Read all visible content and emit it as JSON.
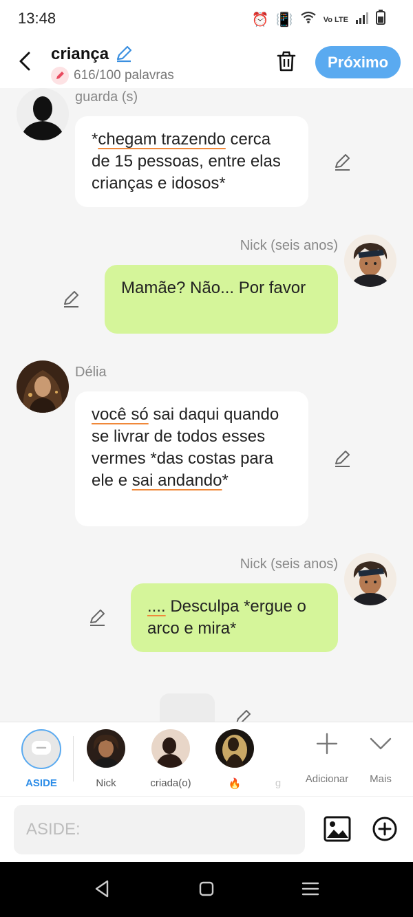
{
  "status": {
    "time": "13:48",
    "network_label": "Vo LTE"
  },
  "header": {
    "title": "criança",
    "word_count": "616/100 palavras",
    "next_label": "Próximo"
  },
  "messages": [
    {
      "sender": "guarda (s)",
      "parts": [
        {
          "t": "*",
          "u": false
        },
        {
          "t": "chegam trazendo",
          "u": true
        },
        {
          "t": " cerca de 15 pessoas, entre elas crianças e idosos*",
          "u": false
        }
      ]
    },
    {
      "sender": "Nick (seis anos)",
      "parts": [
        {
          "t": "Mamãe? Não... Por favor",
          "u": false
        }
      ]
    },
    {
      "sender": "Délia",
      "parts": [
        {
          "t": "você só",
          "u": true
        },
        {
          "t": " sai daqui quando se livrar de todos esses vermes *das costas para ele e ",
          "u": false
        },
        {
          "t": "sai andando",
          "u": true
        },
        {
          "t": "*",
          "u": false
        }
      ]
    },
    {
      "sender": "Nick (seis anos)",
      "parts": [
        {
          "t": "....",
          "u": true
        },
        {
          "t": " Desculpa *ergue o arco e mira*",
          "u": false
        }
      ]
    }
  ],
  "tray": {
    "characters": [
      {
        "name": "ASIDE"
      },
      {
        "name": "Nick"
      },
      {
        "name": "criada(o)"
      },
      {
        "name": "🔥"
      },
      {
        "name": "g"
      }
    ],
    "add_label": "Adicionar",
    "more_label": "Mais"
  },
  "input": {
    "placeholder": "ASIDE:"
  },
  "colors": {
    "accent": "#5aaaf0",
    "green_bubble": "#d5f59a",
    "underline": "#f0883a"
  }
}
